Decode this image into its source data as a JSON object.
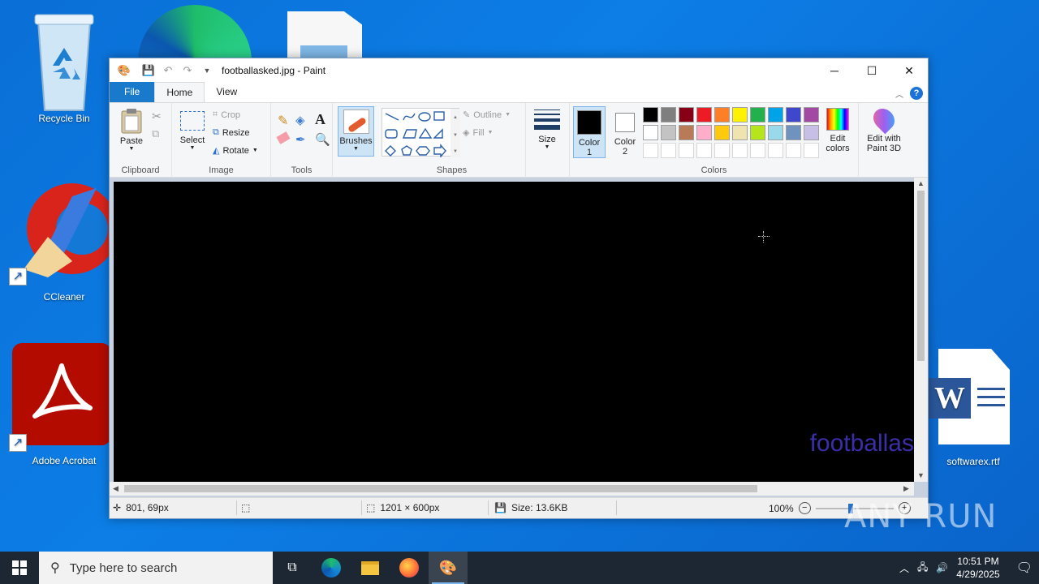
{
  "desktop": {
    "icons": [
      {
        "label": "Recycle Bin"
      },
      {
        "label": "CCleaner"
      },
      {
        "label": "Adobe Acrobat"
      },
      {
        "label": "softwarex.rtf"
      }
    ]
  },
  "window": {
    "title": "footballasked.jpg - Paint",
    "controls": {
      "minimize": "─",
      "maximize": "☐",
      "close": "✕"
    }
  },
  "tabs": {
    "file": "File",
    "home": "Home",
    "view": "View"
  },
  "ribbon": {
    "clipboard": {
      "group": "Clipboard",
      "paste": "Paste"
    },
    "image": {
      "group": "Image",
      "select": "Select",
      "crop": "Crop",
      "resize": "Resize",
      "rotate": "Rotate"
    },
    "tools": {
      "group": "Tools"
    },
    "brushes": {
      "label": "Brushes"
    },
    "shapes": {
      "group": "Shapes",
      "outline": "Outline",
      "fill": "Fill"
    },
    "size": {
      "label": "Size"
    },
    "colors": {
      "group": "Colors",
      "color1": "Color 1",
      "color1_line1": "Color",
      "color1_line2": "1",
      "color2_line1": "Color",
      "color2_line2": "2",
      "edit_colors_line1": "Edit",
      "edit_colors_line2": "colors",
      "palette_row1": [
        "#000000",
        "#7f7f7f",
        "#880015",
        "#ed1c24",
        "#ff7f27",
        "#fff200",
        "#22b14c",
        "#00a2e8",
        "#3f48cc",
        "#a349a4"
      ],
      "palette_row2": [
        "#ffffff",
        "#c3c3c3",
        "#b97a57",
        "#ffaec9",
        "#ffc90e",
        "#efe4b0",
        "#b5e61d",
        "#99d9ea",
        "#7092be",
        "#c8bfe7"
      ]
    },
    "paint3d": {
      "line1": "Edit with",
      "line2": "Paint 3D"
    }
  },
  "canvas": {
    "text": "footballas",
    "text_color": "#3a2fa8",
    "background": "#000000"
  },
  "status": {
    "cursor_pos": "801, 69px",
    "image_dims": "1201 × 600px",
    "file_size": "Size: 13.6KB",
    "zoom": "100%"
  },
  "taskbar": {
    "search_placeholder": "Type here to search",
    "time": "10:51 PM",
    "date": "4/29/2025"
  },
  "watermark": "ANY RUN"
}
